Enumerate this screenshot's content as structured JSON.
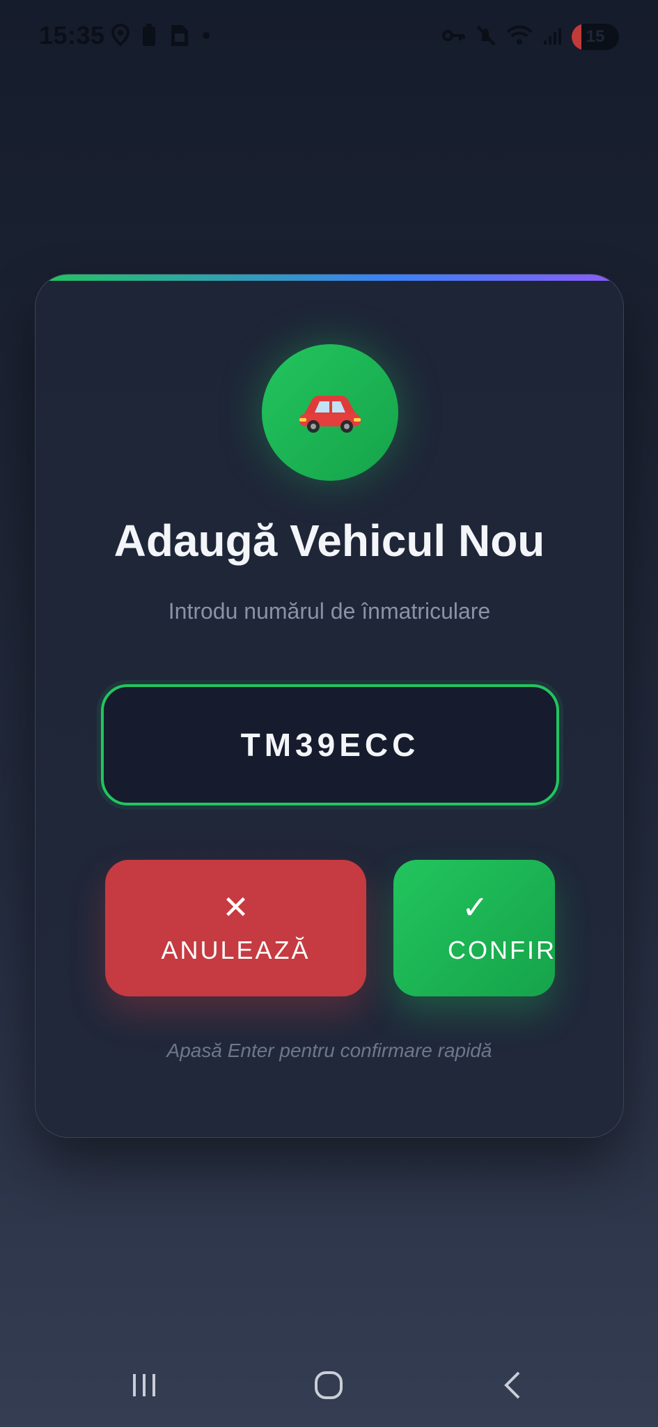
{
  "status_bar": {
    "time": "15:35",
    "left_icons": [
      "location-icon",
      "battery-saver-icon",
      "sim-icon",
      "dot-icon"
    ],
    "right_icons": [
      "key-icon",
      "mute-icon",
      "wifi-icon",
      "signal-icon"
    ],
    "battery_level": "15"
  },
  "dialog": {
    "icon": "🚗",
    "title": "Adaugă Vehicul Nou",
    "subtitle": "Introdu numărul de înmatriculare",
    "plate_value": "TM39ECC",
    "cancel_glyph": "✕",
    "cancel_label": "ANULEAZĂ",
    "confirm_glyph": "✓",
    "confirm_label": "CONFIR",
    "hint": "Apasă Enter pentru confirmare rapidă"
  },
  "colors": {
    "accent_green": "#22c55e",
    "cancel_red": "#c53b41",
    "gradient_blue": "#3b82f6",
    "gradient_purple": "#8b5cf6"
  },
  "nav_bar": {
    "items": [
      "recent-apps-icon",
      "home-icon",
      "back-icon"
    ]
  }
}
